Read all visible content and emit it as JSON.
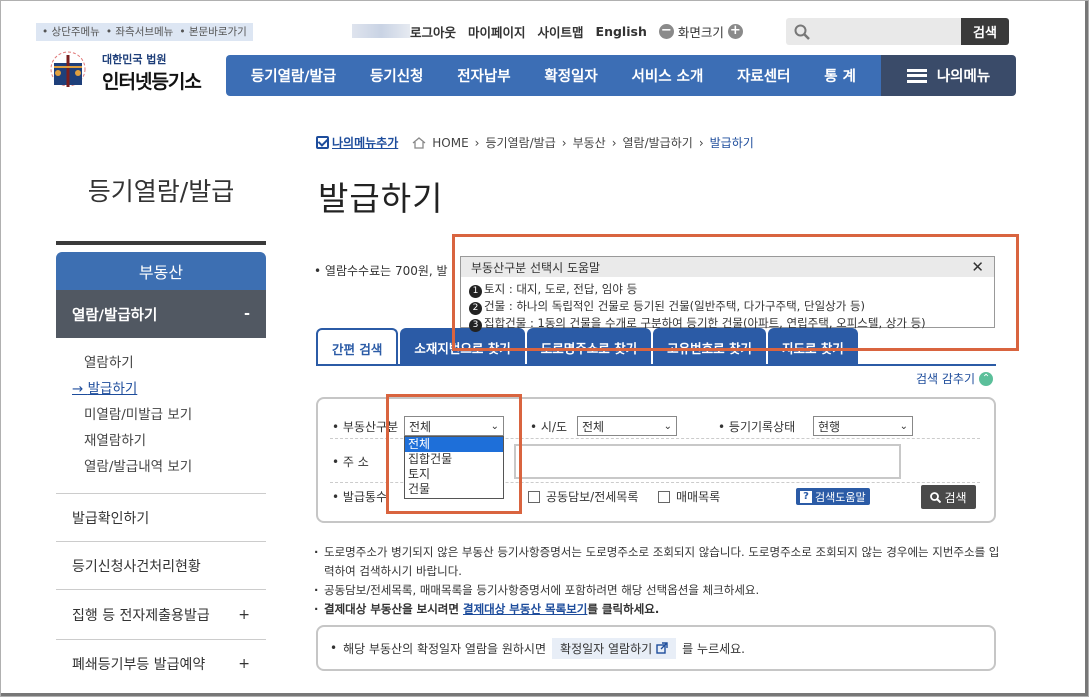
{
  "skip_links": [
    "상단주메뉴",
    "좌측서브메뉴",
    "본문바로가기"
  ],
  "logo": {
    "line1": "대한민국 법원",
    "line2": "인터넷등기소"
  },
  "util": {
    "logout": "로그아웃",
    "mypage": "마이페이지",
    "sitemap": "사이트맵",
    "english": "English",
    "screen_size": "화면크기"
  },
  "search": {
    "button": "검색",
    "placeholder": ""
  },
  "gnb": [
    "등기열람/발급",
    "등기신청",
    "전자납부",
    "확정일자",
    "서비스 소개",
    "자료센터",
    "통 계"
  ],
  "my_menu": "나의메뉴",
  "side": {
    "title": "등기열람/발급",
    "section": "부동산",
    "active": "열람/발급하기",
    "active_sign": "-",
    "subs": [
      "열람하기",
      "발급하기",
      "미열람/미발급 보기",
      "재열람하기",
      "열람/발급내역 보기"
    ],
    "items": [
      {
        "label": "발급확인하기",
        "sign": ""
      },
      {
        "label": "등기신청사건처리현황",
        "sign": ""
      },
      {
        "label": "집행 등 전자제출용발급",
        "sign": "+"
      },
      {
        "label": "폐쇄등기부등 발급예약",
        "sign": "+"
      }
    ]
  },
  "crumb": {
    "add": "나의메뉴추가",
    "path": [
      "HOME",
      "등기열람/발급",
      "부동산",
      "열람/발급하기"
    ],
    "here": "발급하기"
  },
  "page_title": "발급하기",
  "fee_text": "열람수수료는 700원, 발",
  "tabs": [
    "간편 검색",
    "소재지번으로 찾기",
    "도로명주소로 찾기",
    "고유번호로 찾기",
    "지도로 찾기"
  ],
  "fold": "검색 감추기",
  "form": {
    "type_label": "부동산구분",
    "type_value": "전체",
    "type_options": [
      "전체",
      "집합건물",
      "토지",
      "건물"
    ],
    "sido_label": "시/도",
    "sido_value": "전체",
    "status_label": "등기기록상태",
    "status_value": "현행",
    "addr_label": "주 소",
    "count_label": "발급통수",
    "opt1": "공동담보/전세목록",
    "opt2": "매매목록",
    "help": "검색도움말",
    "search": "검색"
  },
  "notes": [
    "도로명주소가 병기되지 않은 부동산 등기사항증명서는 도로명주소로 조회되지 않습니다. 도로명주소로 조회되지 않는 경우에는 지번주소를 입력하여 검색하시기 바랍니다.",
    "공동담보/전세목록, 매매목록을 등기사항증명서에 포함하려면 해당 선택옵션을 체크하세요."
  ],
  "note3": {
    "pre": "결제대상 부동산을 보시려면 ",
    "link": "결제대상 부동산 목록보기",
    "post": "를 클릭하세요."
  },
  "info": {
    "pre": "해당 부동산의 확정일자 열람을 원하시면",
    "btn": "확정일자 열람하기",
    "post": "를 누르세요."
  },
  "popup": {
    "title": "부동산구분 선택시 도움말",
    "close": "✕",
    "lines": [
      "토지 : 대지, 도로, 전답, 임야 등",
      "건물 : 하나의 독립적인 건물로 등기된 건물(일반주택, 다가구주택, 단일상가 등)",
      "집합건물 : 1동의 건물을 수개로 구분하여 등기한 건물(아파트, 연립주택, 오피스텔, 상가 등)"
    ]
  }
}
